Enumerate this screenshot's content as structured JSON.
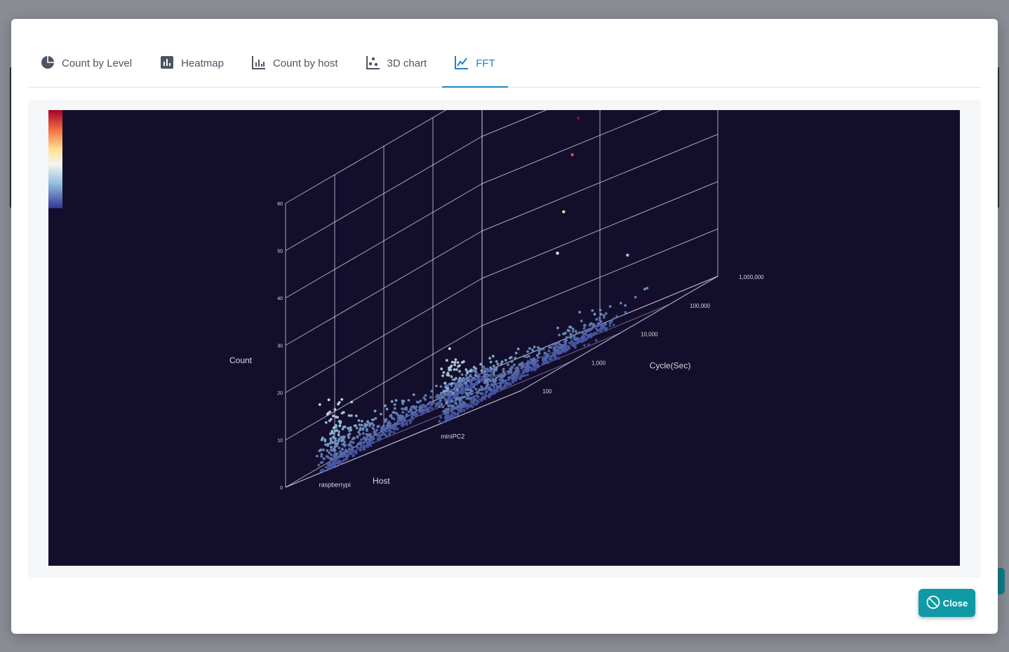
{
  "tabs": [
    {
      "label": "Count by Level",
      "icon": "pie-chart-icon"
    },
    {
      "label": "Heatmap",
      "icon": "bar-chart-icon"
    },
    {
      "label": "Count by host",
      "icon": "histogram-icon"
    },
    {
      "label": "3D chart",
      "icon": "scatter-icon"
    },
    {
      "label": "FFT",
      "icon": "line-chart-icon"
    }
  ],
  "active_tab": "FFT",
  "close_label": "Close",
  "colors": {
    "accent": "#1f83c4",
    "close_button": "#0f9aa5",
    "chart_background": "#130e2c"
  },
  "chart_data": {
    "type": "scatter",
    "mode": "3d",
    "axis_titles": {
      "x": "Host",
      "y": "Cycle(Sec)",
      "z": "Count"
    },
    "x_categories": [
      "raspberrypi",
      "miniPC2"
    ],
    "y_scale": "log",
    "y_ticks": [
      "100",
      "1,000",
      "10,000",
      "100,000",
      "1,000,000"
    ],
    "z_ticks": [
      "0",
      "10",
      "20",
      "30",
      "40",
      "50",
      "60"
    ],
    "z_range": [
      0,
      60
    ],
    "colorscale": "RdYlBu",
    "notable_points": [
      {
        "host": "miniPC2",
        "cycle": 40000,
        "count": 48
      },
      {
        "host": "miniPC2",
        "cycle": 30000,
        "count": 41
      },
      {
        "host": "miniPC2",
        "cycle": 20000,
        "count": 30
      },
      {
        "host": "miniPC2",
        "cycle": 15000,
        "count": 22
      },
      {
        "host": "miniPC2",
        "cycle": 400000,
        "count": 13
      }
    ]
  }
}
